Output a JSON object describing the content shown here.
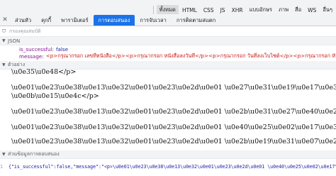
{
  "filters": {
    "items": [
      "ทั้งหมด",
      "HTML",
      "CSS",
      "JS",
      "XHR",
      "แบบอักษร",
      "ภาพ",
      "สื่อ",
      "WS",
      "อื่นๆ"
    ],
    "active_index": 0
  },
  "tabs": {
    "items": [
      "ส่วนหัว",
      "คุกกี้",
      "พารามิเตอร์",
      "การตอบสนอง",
      "การจับเวลา",
      "การติดตามสแตก"
    ],
    "active_index": 3
  },
  "filter_input": {
    "placeholder": "กรองคุณสมบัติ"
  },
  "json_section": {
    "title": "JSON",
    "rows": [
      {
        "key": "is_successful",
        "value": "false",
        "type": "bool"
      },
      {
        "key": "message",
        "value": "<p>กรุณากรอก เลขที่หนังสือ</p><p>กรุณากรอก หนังสือลงวันที่</p><p>กรุณากรอก วันที่ลงเว็บไซต์</p><p>กรุณากรอก หัวเรื่อง</p>",
        "type": "string"
      }
    ]
  },
  "preview_section": {
    "title": "ตัวอย่าง",
    "lines": [
      "\\u0e35\\u0e48</p>",
      "\\u0e01\\u0e23\\u0e38\\u0e13\\u0e32\\u0e01\\u0e23\\u0e2d\\u0e01 \\u0e27\\u0e31\\u0e19\\u0e17\\u0e35\\u0e48\\u0e25",
      "\\u0e0b\\u0e15\\u0e4c</p>",
      "\\u0e01\\u0e23\\u0e38\\u0e13\\u0e32\\u0e01\\u0e23\\u0e2d\\u0e01 \\u0e2b\\u0e31\\u0e27\\u0e40\\u0e23\\u0e37\\u0e48",
      "\\u0e01\\u0e23\\u0e38\\u0e13\\u0e32\\u0e01\\u0e23\\u0e2d\\u0e01 \\u0e40\\u0e25\\u0e02\\u0e17\\u0e35\\u0e48\\u0e2b",
      "\\u0e01\\u0e23\\u0e38\\u0e13\\u0e32\\u0e01\\u0e23\\u0e2d\\u0e01 \\u0e2b\\u0e19\\u0e31\\u0e07\\u0e2a\\u0e37\\u0e2d\\u0e25"
    ]
  },
  "raw_section": {
    "title": "ส่วนข้อมูลการตอบสนอง",
    "line_number": "1",
    "text": "{\"is_successful\":false,\"message\":\"<p>\\u0e01\\u0e23\\u0e38\\u0e13\\u0e32\\u0e01\\u0e23\\u0e2d\\u0e01 \\u0e40\\u0e25\\u0e02\\u0e17\\u0e35\\u0e48\\u0e2b"
  }
}
